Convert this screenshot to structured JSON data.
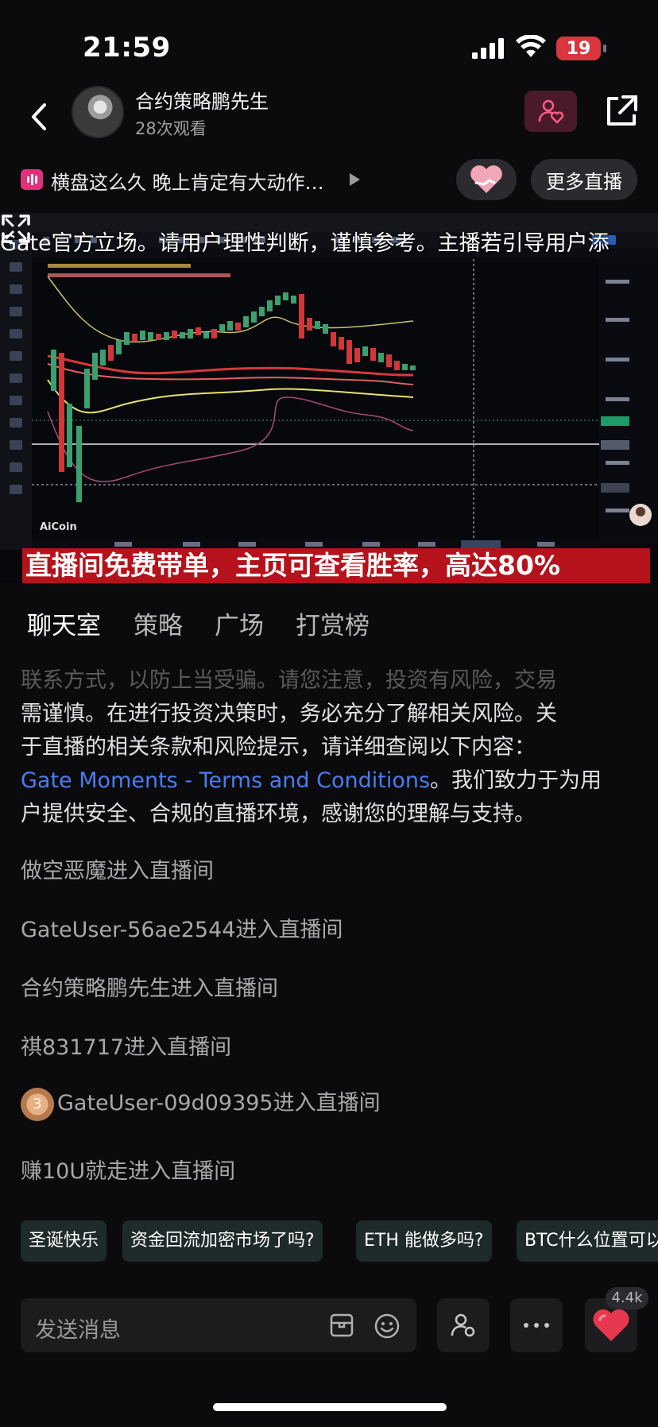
{
  "status_bar": {
    "time": "21:59",
    "battery": "19"
  },
  "header": {
    "host_name": "合约策略鹏先生",
    "views": "28次观看"
  },
  "ticker": {
    "title": "横盘这么久 晚上肯定有大动作…",
    "more_live_label": "更多直播"
  },
  "video": {
    "disclaimer": "Gate官方立场。请用户理性判断，谨慎参考。主播若引导用户添",
    "banner": "直播间免费带单，主页可查看胜率，高达80%",
    "watermark": "AiCoin"
  },
  "tabs": [
    {
      "label": "聊天室"
    },
    {
      "label": "策略"
    },
    {
      "label": "广场"
    },
    {
      "label": "打赏榜"
    }
  ],
  "chat": {
    "notice_faded": "联系方式，以防上当受骗。请您注意，投资有风险，交易",
    "notice_line1": "需谨慎。在进行投资决策时，务必充分了解相关风险。关",
    "notice_line2": "于直播的相关条款和风险提示，请详细查阅以下内容：",
    "notice_link": "Gate Moments - Terms and Conditions",
    "notice_after_link": "。我们致力于为用",
    "notice_line4": "户提供安全、合规的直播环境，感谢您的理解与支持。",
    "messages": [
      {
        "text": "做空恶魔进入直播间"
      },
      {
        "text": "GateUser-56ae2544进入直播间"
      },
      {
        "text": "合约策略鹏先生进入直播间"
      },
      {
        "text": "祺831717进入直播间"
      },
      {
        "text": "GateUser-09d09395进入直播间",
        "badge": "3"
      },
      {
        "text": "赚10U就走进入直播间"
      }
    ]
  },
  "quick_chips": [
    {
      "label": "圣诞快乐"
    },
    {
      "label": "资金回流加密市场了吗?"
    },
    {
      "label": "ETH 能做多吗?"
    },
    {
      "label": "BTC什么位置可以"
    }
  ],
  "bottom_bar": {
    "input_placeholder": "发送消息",
    "like_count": "4.4k"
  },
  "colors": {
    "link": "#4a7cf2",
    "banner": "#b5121b",
    "follow_bg": "#4a1a2a",
    "like_heart": "#e8384f"
  }
}
